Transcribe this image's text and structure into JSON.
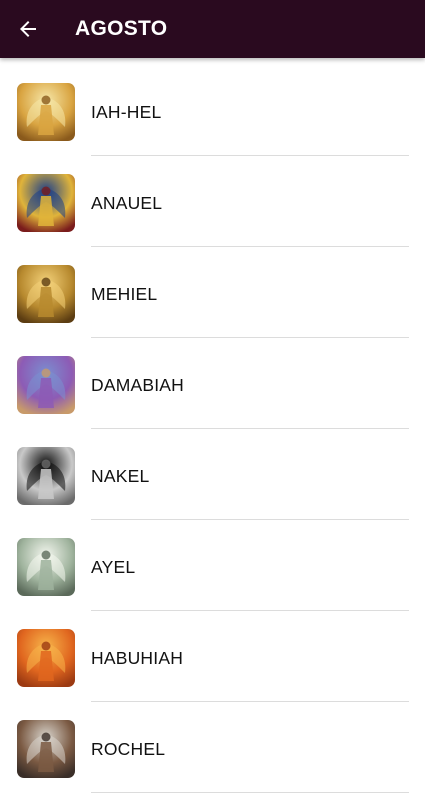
{
  "header": {
    "title": "AGOSTO",
    "back_icon": "arrow-back-icon",
    "background": "#2a0a1f"
  },
  "angels": [
    {
      "name": "IAH-HEL",
      "image": "angel-golden-light-image",
      "colors": [
        "#f6e7a8",
        "#d9a441",
        "#8a5a1c"
      ]
    },
    {
      "name": "ANAUEL",
      "image": "angel-blue-sky-image",
      "colors": [
        "#1c3f8a",
        "#e0b43a",
        "#7a1c1c"
      ]
    },
    {
      "name": "MEHIEL",
      "image": "angel-golden-wings-image",
      "colors": [
        "#f4d27a",
        "#b7892e",
        "#5c3d12"
      ]
    },
    {
      "name": "DAMABIAH",
      "image": "angel-purple-robe-image",
      "colors": [
        "#7a8fd0",
        "#8d5bb5",
        "#c89a6a"
      ]
    },
    {
      "name": "NAKEL",
      "image": "angel-stone-statue-image",
      "colors": [
        "#0d0d0d",
        "#c9c9c9",
        "#6b6b6b"
      ]
    },
    {
      "name": "AYEL",
      "image": "angel-trumpet-light-image",
      "colors": [
        "#f4f7ef",
        "#9fb39d",
        "#5b6a5a"
      ]
    },
    {
      "name": "HABUHIAH",
      "image": "angel-fire-image",
      "colors": [
        "#f7b44a",
        "#e0661f",
        "#9c3a12"
      ]
    },
    {
      "name": "ROCHEL",
      "image": "angel-warrior-image",
      "colors": [
        "#d8d4cc",
        "#7b5a43",
        "#3a2e28"
      ]
    }
  ]
}
